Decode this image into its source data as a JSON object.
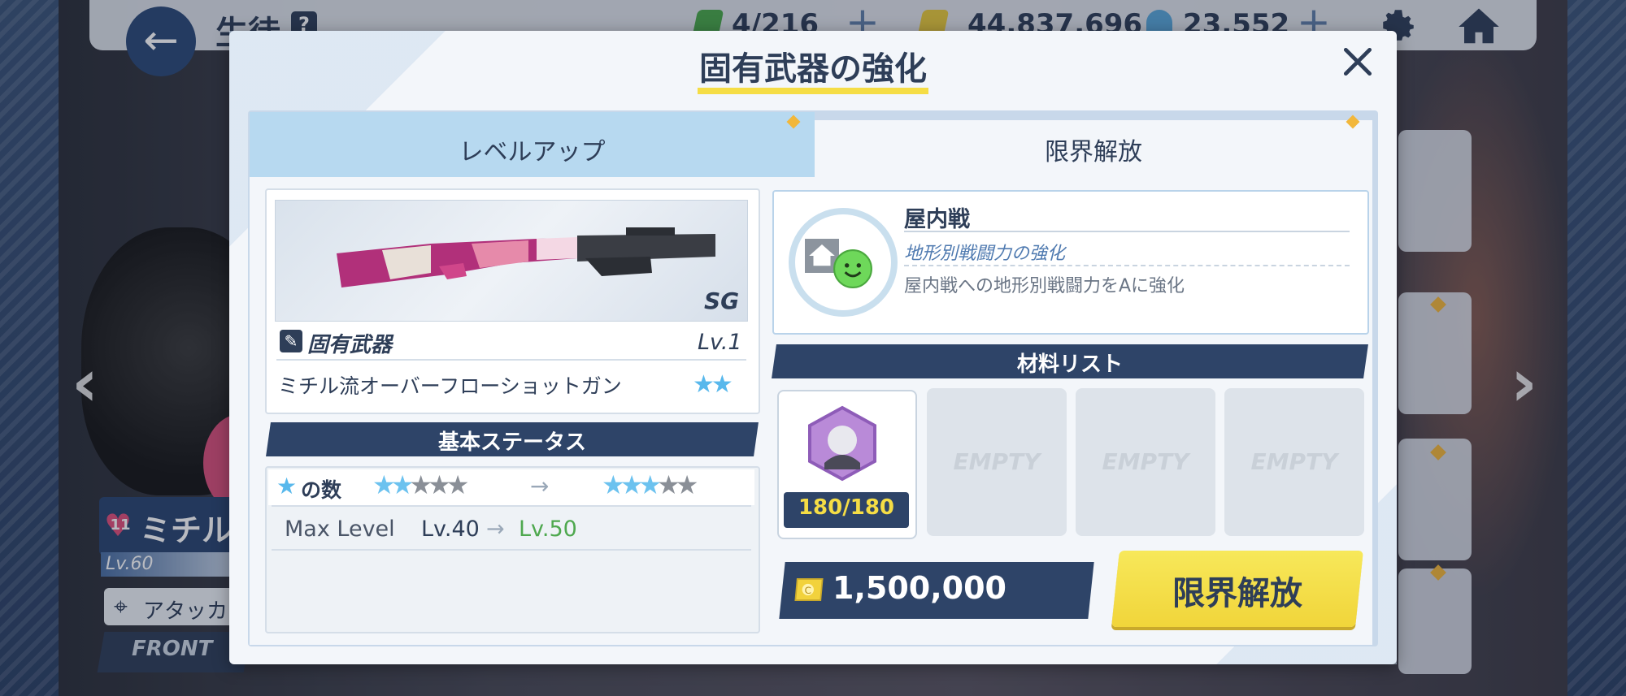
{
  "top_bar": {
    "title": "生徒",
    "help": "?",
    "ap": "4/216",
    "credits": "44,837,696",
    "gems": "23,552"
  },
  "character": {
    "name": "ミチル",
    "bond": "11",
    "level": "Lv.60",
    "role": "アタッカー",
    "position": "FRONT"
  },
  "modal": {
    "title": "固有武器の強化",
    "tabs": [
      {
        "label": "レベルアップ",
        "active": false
      },
      {
        "label": "限界解放",
        "active": true
      }
    ],
    "weapon": {
      "type": "SG",
      "category": "固有武器",
      "level": "Lv.1",
      "name": "ミチル流オーバーフローショットガン",
      "stars": "★★"
    },
    "status": {
      "header": "基本ステータス",
      "star_label": "の数",
      "stars_before": {
        "on": 2,
        "total": 5
      },
      "stars_after": {
        "on": 3,
        "total": 5
      },
      "max_level_label": "Max Level",
      "max_level_from": "Lv.40",
      "max_level_to": "Lv.50"
    },
    "skill": {
      "name": "屋内戦",
      "subtitle": "地形別戦闘力の強化",
      "description": "屋内戦への地形別戦闘力をAに強化"
    },
    "materials": {
      "header": "材料リスト",
      "item_count": "180/180",
      "empty_label": "EMPTY"
    },
    "cost": "1,500,000",
    "action_label": "限界解放"
  },
  "colors": {
    "navy": "#2e4468",
    "accent_yellow": "#f5dd45",
    "tab_blue": "#b7d9f0",
    "star_blue": "#6cc2ef",
    "level_green": "#4ea84e"
  }
}
